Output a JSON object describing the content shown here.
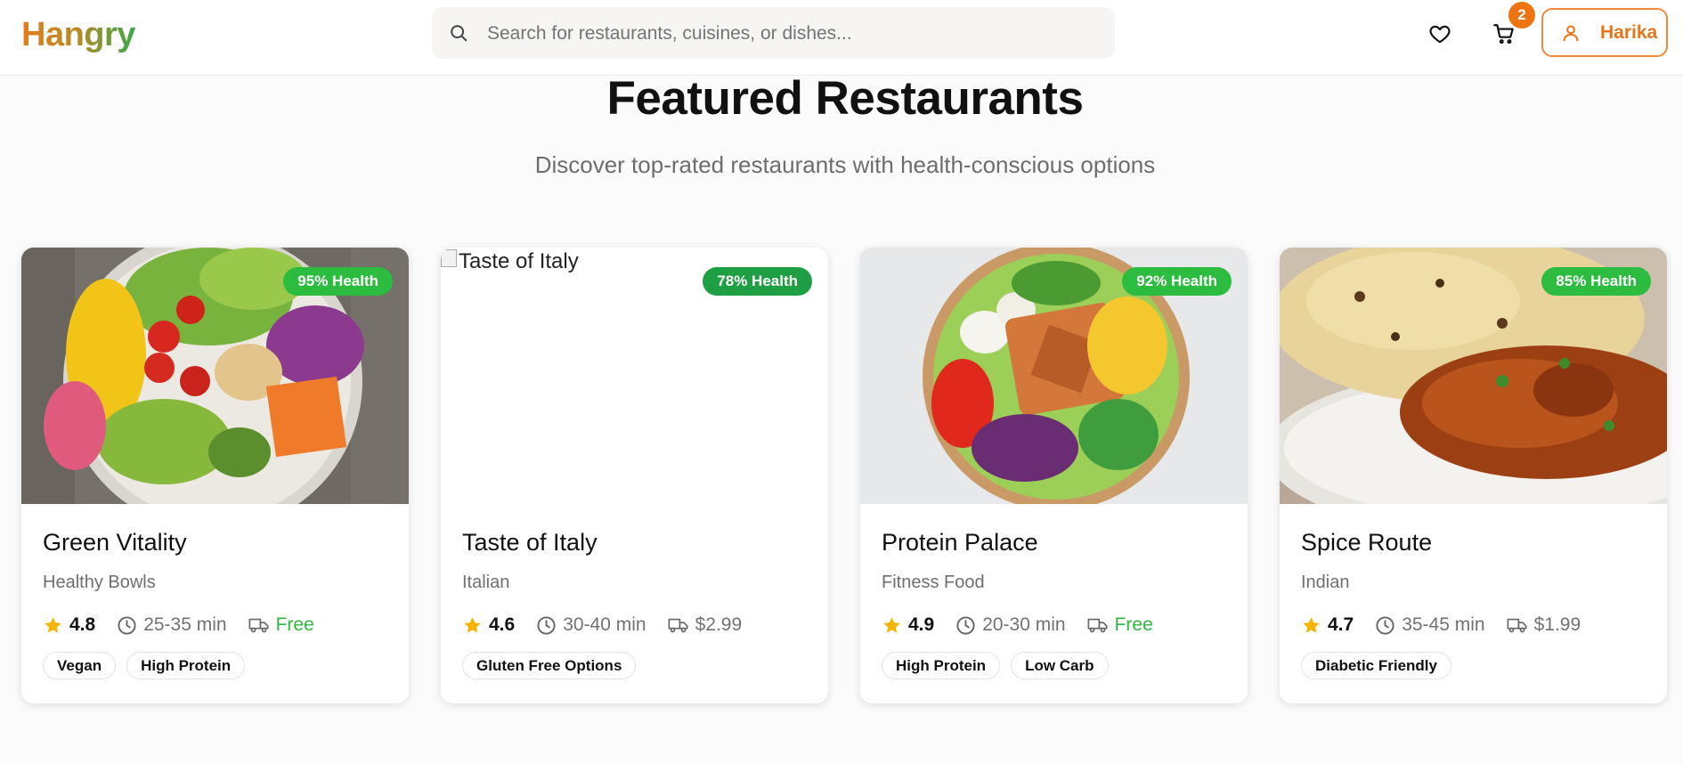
{
  "header": {
    "logo": "Hangry",
    "search_placeholder": "Search for restaurants, cuisines, or dishes...",
    "cart_count": "2",
    "user_name": "Harika",
    "icons": [
      "search-icon",
      "heart-icon",
      "cart-icon",
      "user-icon"
    ]
  },
  "section": {
    "title": "Featured Restaurants",
    "subtitle": "Discover top-rated restaurants with health-conscious options"
  },
  "restaurants": [
    {
      "name": "Green Vitality",
      "cuisine": "Healthy Bowls",
      "health": "95% Health",
      "rating": "4.8",
      "time": "25-35 min",
      "fee": "Free",
      "tags": [
        "Vegan",
        "High Protein"
      ],
      "image": "salad-bowl-photo"
    },
    {
      "name": "Taste of Italy",
      "cuisine": "Italian",
      "health": "78% Health",
      "rating": "4.6",
      "time": "30-40 min",
      "fee": "$2.99",
      "tags": [
        "Gluten Free Options"
      ],
      "image_alt": "Taste of Italy"
    },
    {
      "name": "Protein Palace",
      "cuisine": "Fitness Food",
      "health": "92% Health",
      "rating": "4.9",
      "time": "20-30 min",
      "fee": "Free",
      "tags": [
        "High Protein",
        "Low Carb"
      ],
      "image": "protein-bowl-photo"
    },
    {
      "name": "Spice Route",
      "cuisine": "Indian",
      "health": "85% Health",
      "rating": "4.7",
      "time": "35-45 min",
      "fee": "$1.99",
      "tags": [
        "Diabetic Friendly"
      ],
      "image": "curry-naan-photo"
    }
  ],
  "colors": {
    "brand_orange": "#ea7416",
    "brand_green": "#3aa84a",
    "free_green": "#2fb742",
    "badge_green": "#2cbc3f",
    "star_yellow": "#f5b400"
  }
}
